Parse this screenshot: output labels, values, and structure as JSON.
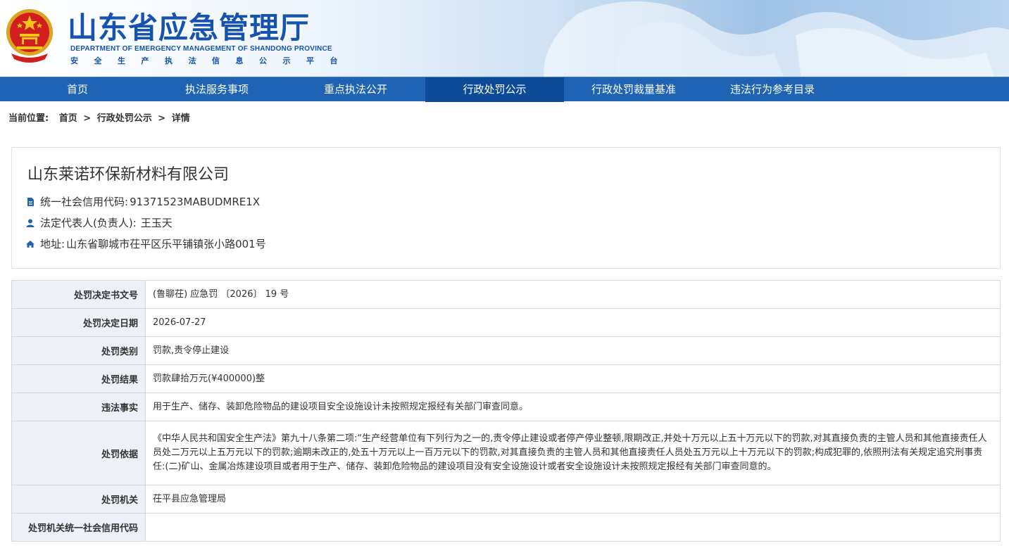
{
  "header": {
    "title": "山东省应急管理厅",
    "title_en": "DEPARTMENT OF EMERGENCY MANAGEMENT OF SHANDONG PROVINCE",
    "subtitle": "安全生产执法信息公示平台"
  },
  "nav": {
    "items": [
      {
        "label": "首页"
      },
      {
        "label": "执法服务事项"
      },
      {
        "label": "重点执法公开"
      },
      {
        "label": "行政处罚公示"
      },
      {
        "label": "行政处罚裁量基准"
      },
      {
        "label": "违法行为参考目录"
      }
    ],
    "active_index": 3
  },
  "breadcrumb": {
    "label": "当前位置:",
    "items": [
      "首页",
      "行政处罚公示",
      "详情"
    ],
    "separator": ">"
  },
  "company": {
    "name": "山东莱诺环保新材料有限公司",
    "credit_code_label": "统一社会信用代码:",
    "credit_code": "91371523MABUDMRE1X",
    "legal_rep_label": "法定代表人(负责人):",
    "legal_rep": "王玉天",
    "address_label": "地址:",
    "address": "山东省聊城市茌平区乐平铺镇张小路001号"
  },
  "detail": {
    "rows": [
      {
        "label": "处罚决定书文号",
        "value": "(鲁聊茌) 应急罚 〔2026〕 19 号"
      },
      {
        "label": "处罚决定日期",
        "value": "2026-07-27"
      },
      {
        "label": "处罚类别",
        "value": "罚款,责令停止建设"
      },
      {
        "label": "处罚结果",
        "value": "罚款肆拾万元(¥400000)整"
      },
      {
        "label": "违法事实",
        "value": "用于生产、储存、装卸危险物品的建设项目安全设施设计未按照规定报经有关部门审查同意。"
      },
      {
        "label": "处罚依据",
        "value": "《中华人民共和国安全生产法》第九十八条第二项:“生产经营单位有下列行为之一的,责令停止建设或者停产停业整顿,限期改正,并处十万元以上五十万元以下的罚款,对其直接负责的主管人员和其他直接责任人员处二万元以上五万元以下的罚款;逾期未改正的,处五十万元以上一百万元以下的罚款,对其直接负责的主管人员和其他直接责任人员处五万元以上十万元以下的罚款;构成犯罪的,依照刑法有关规定追究刑事责任:(二)矿山、金属冶炼建设项目或者用于生产、储存、装卸危险物品的建设项目没有安全设施设计或者安全设施设计未按照规定报经有关部门审查同意的。"
      },
      {
        "label": "处罚机关",
        "value": "茌平县应急管理局"
      },
      {
        "label": "处罚机关统一社会信用代码",
        "value": ""
      }
    ]
  },
  "colors": {
    "nav_bg": "#1e63b4",
    "nav_active": "#0d4a98",
    "title_blue": "#1453b0",
    "label_bg": "#eef0f7"
  }
}
